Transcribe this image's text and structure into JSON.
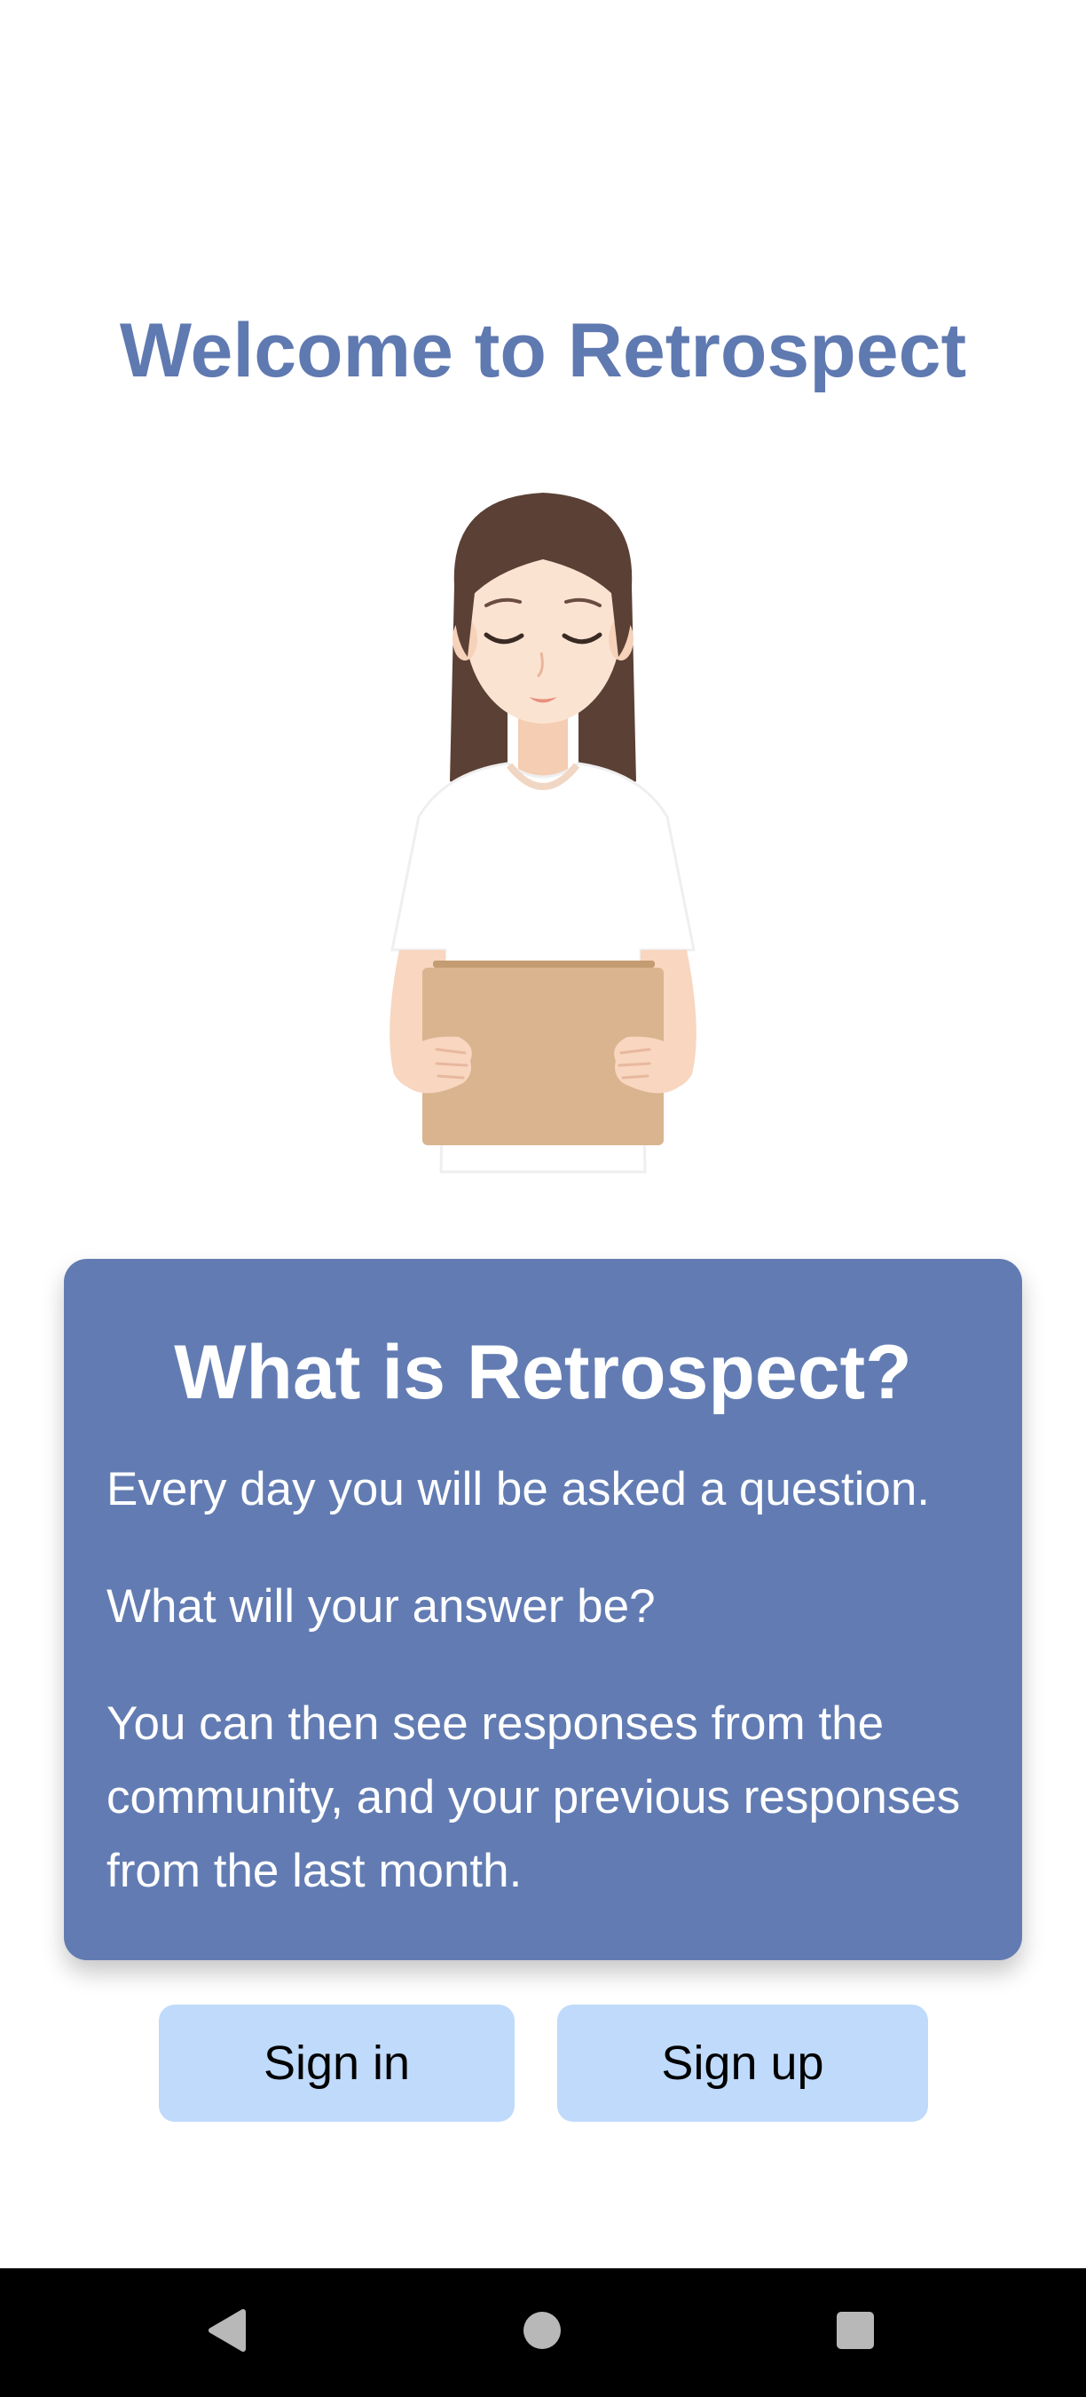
{
  "header": {
    "title": "Welcome to Retrospect"
  },
  "illustration": {
    "icon": "woman-reading-clipboard-illustration"
  },
  "info_card": {
    "title": "What is Retrospect?",
    "paragraphs": [
      "Every day you will be asked a question.",
      "What will your answer be?",
      "You can then see responses from the community, and your previous responses from the last month."
    ]
  },
  "actions": {
    "sign_in_label": "Sign in",
    "sign_up_label": "Sign up"
  },
  "nav_bar": {
    "back_icon": "back-triangle-icon",
    "home_icon": "home-circle-icon",
    "recents_icon": "recents-square-icon"
  },
  "colors": {
    "title": "#5F79B1",
    "card_background": "#627CB3",
    "button_background": "#BFDAFB",
    "nav_bar_background": "#000000",
    "nav_icon": "#B8B8B8"
  }
}
